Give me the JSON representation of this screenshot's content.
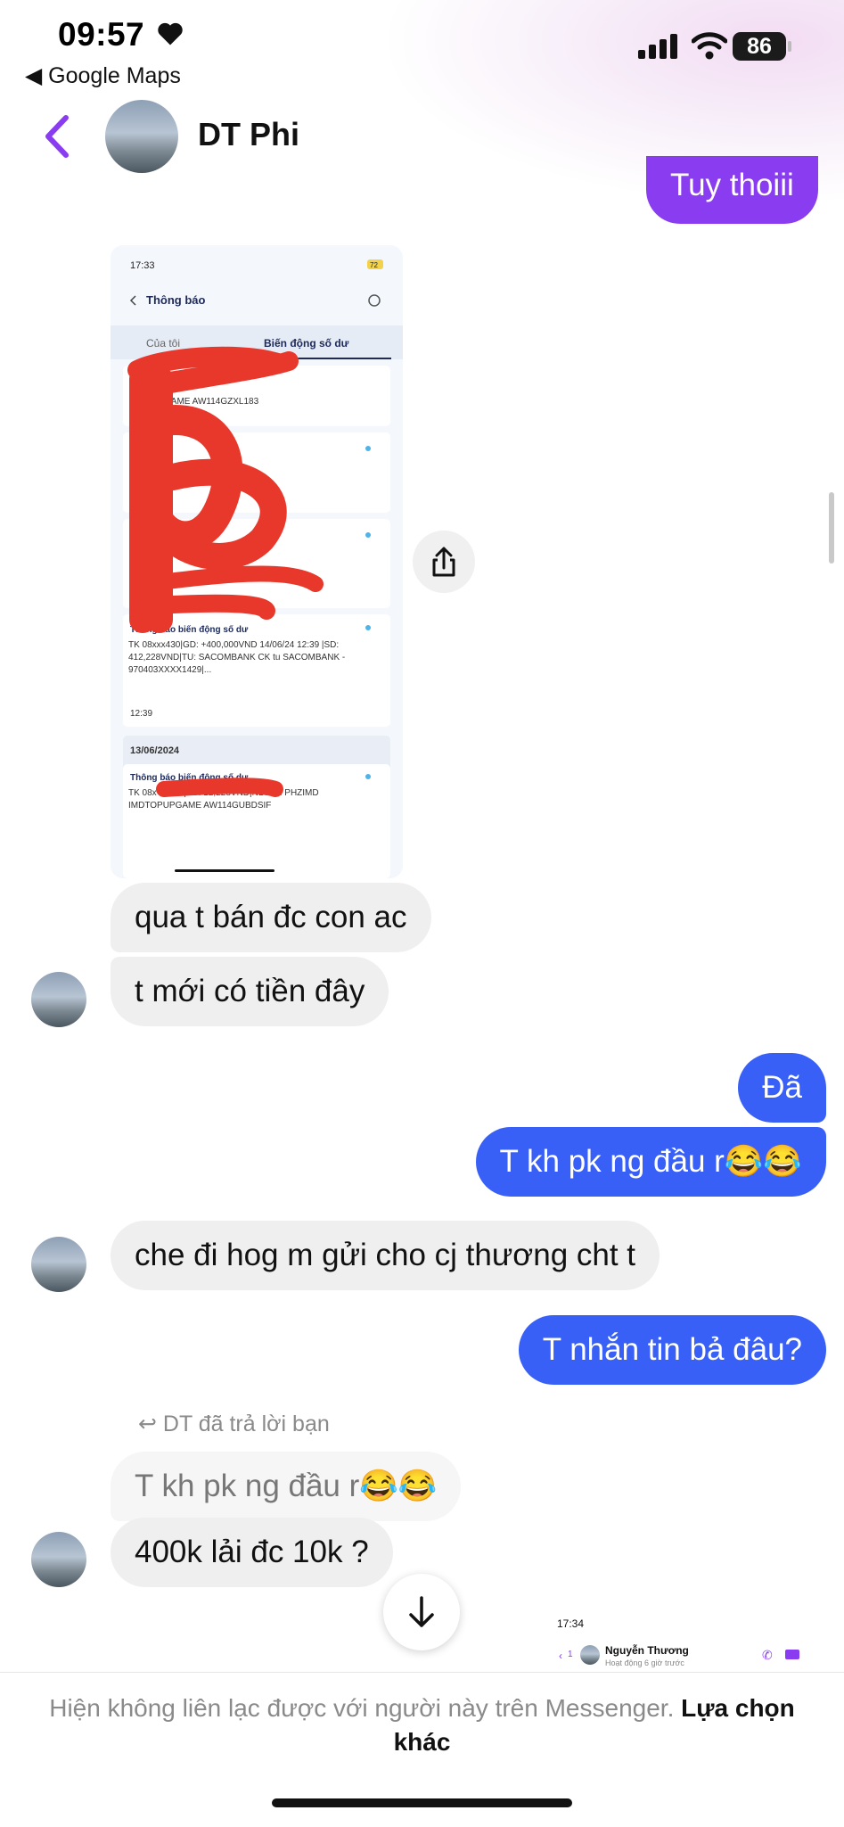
{
  "status_bar": {
    "time": "09:57",
    "back_app": "◀ Google Maps",
    "battery": "86"
  },
  "header": {
    "contact_name": "DT Phi"
  },
  "messages": {
    "top_partial": "Tuy thoiii",
    "m1": "qua t bán đc con ac",
    "m2": "t mới có tiền đây",
    "m3": "Đã",
    "m4": "T kh pk ng đầu r😂😂",
    "m5": "che đi hog m gửi cho cj thương cht t",
    "m6": "T nhắn tin bả đâu?",
    "reply_meta": "DT đã trả lời bạn",
    "reply_quote": "T kh pk ng đầu r😂😂",
    "m7": "400k lải đc 10k ?"
  },
  "screenshot_image": {
    "time": "17:33",
    "battery": "72",
    "title": "Thông báo",
    "tab_mine": "Của tôi",
    "tab_balance": "Biến động số dư",
    "row1_text": "TK 08x",
    "row1_sub": "GAME AW114GZXL183",
    "row_time_a": "21:02",
    "row2_title": "Thông báo biến động số dư",
    "row2_body": "TK 08xxx430|GD: +400,000VND 14/06/24 12:39 |SD: 412,228VND|TU: SACOMBANK CK tu SACOMBANK - 970403XXXX1429|...",
    "row2_time": "12:39",
    "date_header": "13/06/2024",
    "row3_title": "Thông báo biến động số dư",
    "row3_body": "TK 08x 09:41 |SD: 12,228VND|ND: PH PHZIMD IMDTOPUPGAME AW114GUBDSIF"
  },
  "peek_screenshot": {
    "time": "17:34",
    "name": "Nguyễn Thương",
    "status": "Hoạt động 6 giờ trước",
    "badge": "1"
  },
  "footer": {
    "notice": "Hiện không liên lạc được với người này trên Messenger.",
    "action": "Lựa chọn khác"
  },
  "colors": {
    "accent_blue": "#3960f6",
    "accent_purple": "#8a3df0",
    "incoming_bg": "#efefef",
    "redaction": "#e8382c"
  }
}
